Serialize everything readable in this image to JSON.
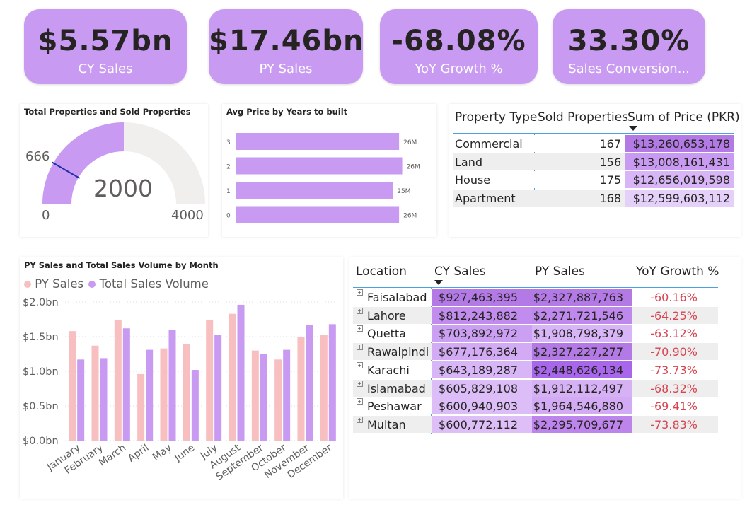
{
  "kpis": [
    {
      "value": "$5.57bn",
      "label": "CY Sales"
    },
    {
      "value": "$17.46bn",
      "label": "PY Sales"
    },
    {
      "value": "-68.08%",
      "label": "YoY Growth %"
    },
    {
      "value": "33.30%",
      "label": "Sales Conversion..."
    }
  ],
  "gauge": {
    "title": "Total Properties and Sold Properties",
    "value": "2000",
    "target": "666",
    "min": "0",
    "max": "4000",
    "value_num": 2000,
    "target_num": 666,
    "min_num": 0,
    "max_num": 4000
  },
  "avg_price": {
    "title": "Avg Price by Years to built",
    "bars": [
      {
        "category": "3",
        "label": "26M",
        "value": 26
      },
      {
        "category": "2",
        "label": "26M",
        "value": 26.5
      },
      {
        "category": "1",
        "label": "25M",
        "value": 25
      },
      {
        "category": "0",
        "label": "26M",
        "value": 26
      }
    ]
  },
  "property_table": {
    "headers": [
      "Property Type",
      "Sold Properties",
      "Sum of Price (PKR)"
    ],
    "rows": [
      {
        "type": "Commercial",
        "sold": "167",
        "price": "$13,260,653,178"
      },
      {
        "type": "Land",
        "sold": "156",
        "price": "$13,008,161,431"
      },
      {
        "type": "House",
        "sold": "175",
        "price": "$12,656,019,598"
      },
      {
        "type": "Apartment",
        "sold": "168",
        "price": "$12,599,603,112"
      }
    ]
  },
  "chart_data": {
    "type": "bar",
    "title": "PY Sales and Total Sales Volume by Month",
    "categories": [
      "January",
      "February",
      "March",
      "April",
      "May",
      "June",
      "July",
      "August",
      "September",
      "October",
      "November",
      "December"
    ],
    "series": [
      {
        "name": "PY Sales",
        "color": "#f7bfbf",
        "values": [
          1.58,
          1.37,
          1.74,
          0.96,
          1.33,
          1.39,
          1.74,
          1.83,
          1.3,
          1.17,
          1.5,
          1.52
        ]
      },
      {
        "name": "Total Sales Volume",
        "color": "#c99af2",
        "values": [
          1.17,
          1.19,
          1.62,
          1.31,
          1.6,
          1.02,
          1.53,
          1.96,
          1.25,
          1.31,
          1.67,
          1.68
        ]
      }
    ],
    "yticks": [
      "$0.0bn",
      "$0.5bn",
      "$1.0bn",
      "$1.5bn",
      "$2.0bn"
    ],
    "ylim": [
      0,
      2.0
    ],
    "legend": "top-left",
    "grid": true
  },
  "location_table": {
    "headers": [
      "Location",
      "CY Sales",
      "PY Sales",
      "YoY Growth %"
    ],
    "rows": [
      {
        "location": "Faisalabad",
        "cy": "$927,463,395",
        "py": "$2,327,887,763",
        "yoy": "-60.16%"
      },
      {
        "location": "Lahore",
        "cy": "$812,243,882",
        "py": "$2,271,721,546",
        "yoy": "-64.25%"
      },
      {
        "location": "Quetta",
        "cy": "$703,892,972",
        "py": "$1,908,798,379",
        "yoy": "-63.12%"
      },
      {
        "location": "Rawalpindi",
        "cy": "$677,176,364",
        "py": "$2,327,227,277",
        "yoy": "-70.90%"
      },
      {
        "location": "Karachi",
        "cy": "$643,189,287",
        "py": "$2,448,626,134",
        "yoy": "-73.73%"
      },
      {
        "location": "Islamabad",
        "cy": "$605,829,108",
        "py": "$1,912,112,497",
        "yoy": "-68.32%"
      },
      {
        "location": "Peshawar",
        "cy": "$600,940,903",
        "py": "$1,964,546,880",
        "yoy": "-69.41%"
      },
      {
        "location": "Multan",
        "cy": "$600,772,112",
        "py": "$2,295,709,677",
        "yoy": "-73.83%"
      }
    ]
  },
  "colors": {
    "accent": "#c99af2",
    "accent_dark": "#a866ec",
    "py": "#f7bfbf",
    "negative": "#d64550",
    "track": "#f0efee",
    "target_line": "#1f2fa8"
  }
}
